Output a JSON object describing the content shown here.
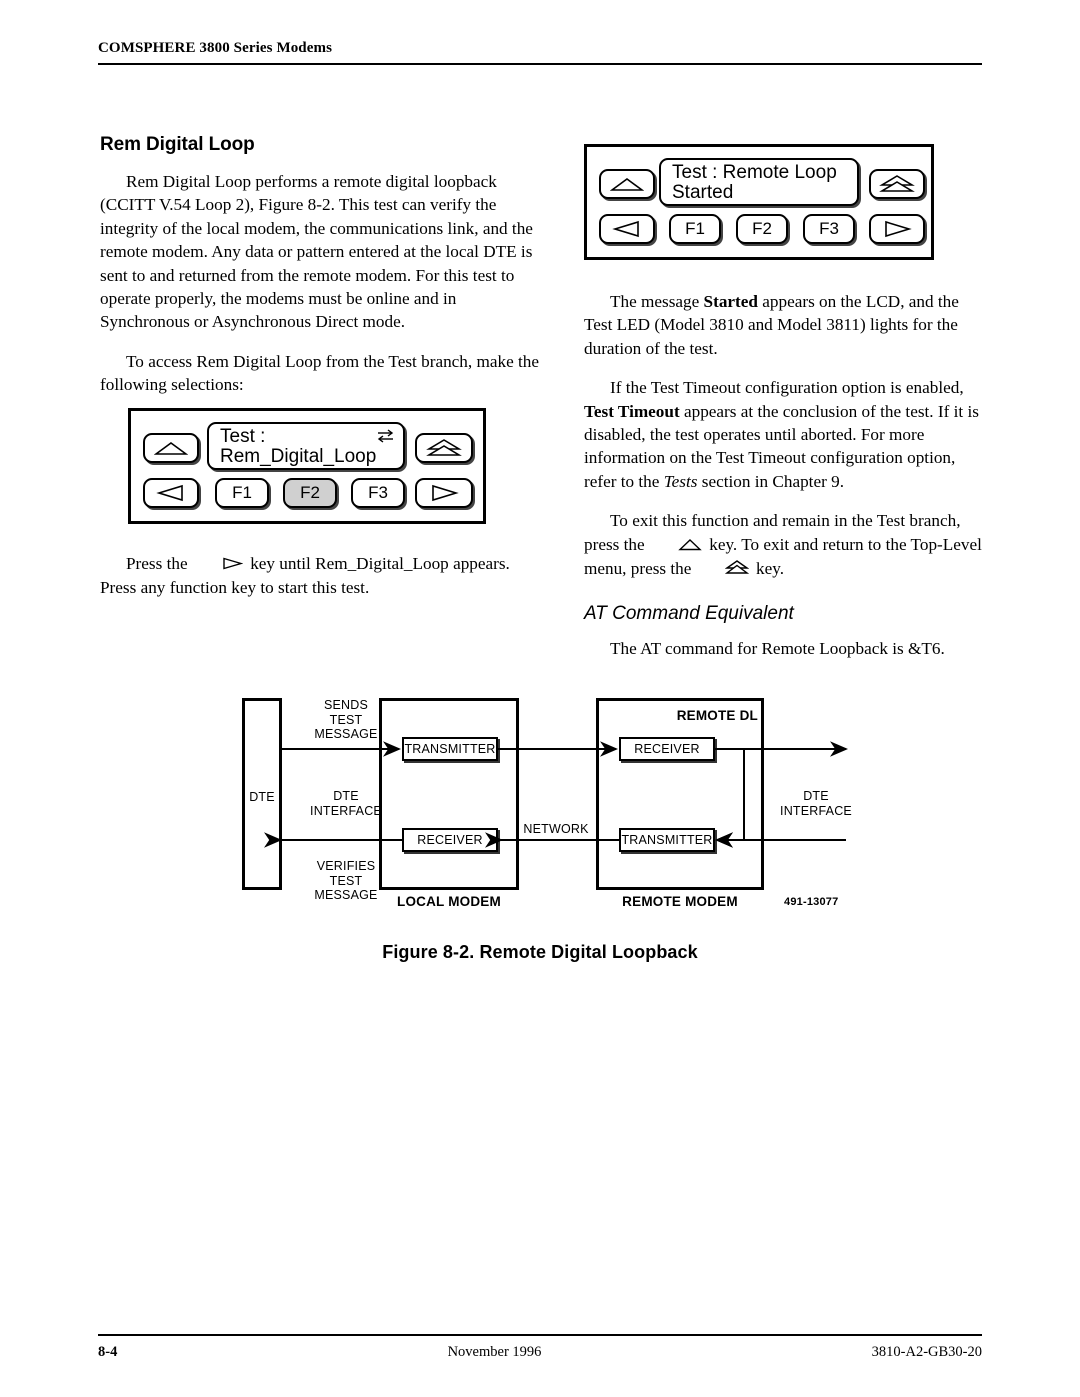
{
  "header": {
    "running_head": "COMSPHERE 3800 Series Modems"
  },
  "left_column": {
    "section_title": "Rem Digital Loop",
    "paragraph_1": "Rem Digital Loop performs a remote digital loopback (CCITT V.54 Loop 2), Figure 8-2. This test can verify the integrity of the local modem, the communications link, and the remote modem. Any data or pattern entered at the local DTE is sent to and returned from the remote modem. For this test to operate properly, the modems must be online and in Synchronous or Asynchronous Direct mode.",
    "paragraph_2": "To access Rem Digital Loop from the Test branch, make the following selections:",
    "paragraph_3_a": "Press the",
    "paragraph_3_b": "key until Rem_Digital_Loop appears. Press any function key to start this test."
  },
  "panel_left": {
    "lcd_line_1": "Test :",
    "lcd_line_2": "Rem_Digital_Loop",
    "lcd_icon": "left-right-arrows-icon",
    "up_key": "up-arrow-key-icon",
    "top_key": "top-level-menu-key-icon",
    "left_key": "left-arrow-key-icon",
    "right_key": "right-arrow-key-icon",
    "f_keys": [
      "F1",
      "F2",
      "F3"
    ],
    "selected_f_key": "F2"
  },
  "panel_right": {
    "lcd_line_1": "Test : Remote Loop",
    "lcd_line_2": "Started",
    "up_key": "up-arrow-key-icon",
    "top_key": "top-level-menu-key-icon",
    "left_key": "left-arrow-key-icon",
    "right_key": "right-arrow-key-icon",
    "f_keys": [
      "F1",
      "F2",
      "F3"
    ],
    "selected_f_key": ""
  },
  "right_column": {
    "paragraph_1_a": "The message ",
    "paragraph_1_bold": "Started",
    "paragraph_1_b": " appears on the LCD, and the Test LED (Model 3810 and Model 3811) lights for the duration of the test.",
    "paragraph_2_a": "If the Test Timeout configuration option is enabled, ",
    "paragraph_2_bold": "Test Timeout",
    "paragraph_2_b": " appears at the conclusion of the test. If it is disabled, the test operates until aborted. For more information on the Test Timeout configuration option, refer to the ",
    "paragraph_2_italic": "Tests",
    "paragraph_2_c": " section in Chapter 9.",
    "paragraph_3_a": "To exit this function and remain in the Test branch, press the",
    "paragraph_3_b": "key. To exit and return to the Top-Level menu, press the",
    "paragraph_3_c": "key.",
    "subsection_title": "AT Command Equivalent",
    "paragraph_4": "The AT command for Remote Loopback is &T6."
  },
  "figure": {
    "caption": "Figure 8-2.  Remote Digital Loopback",
    "part_number": "491-13077",
    "dte_label": "DTE",
    "sends_test_message": "SENDS\nTEST\nMESSAGE",
    "dte_interface_left": "DTE\nINTERFACE",
    "verifies_test_message": "VERIFIES\nTEST\nMESSAGE",
    "local_transmitter": "TRANSMITTER",
    "local_receiver": "RECEIVER",
    "local_modem": "LOCAL MODEM",
    "network_label": "NETWORK",
    "remote_dl": "REMOTE DL",
    "remote_receiver": "RECEIVER",
    "remote_transmitter": "TRANSMITTER",
    "remote_modem": "REMOTE MODEM",
    "dte_interface_right": "DTE\nINTERFACE"
  },
  "footer": {
    "page_number": "8-4",
    "date": "November 1996",
    "doc_number": "3810-A2-GB30-20"
  }
}
